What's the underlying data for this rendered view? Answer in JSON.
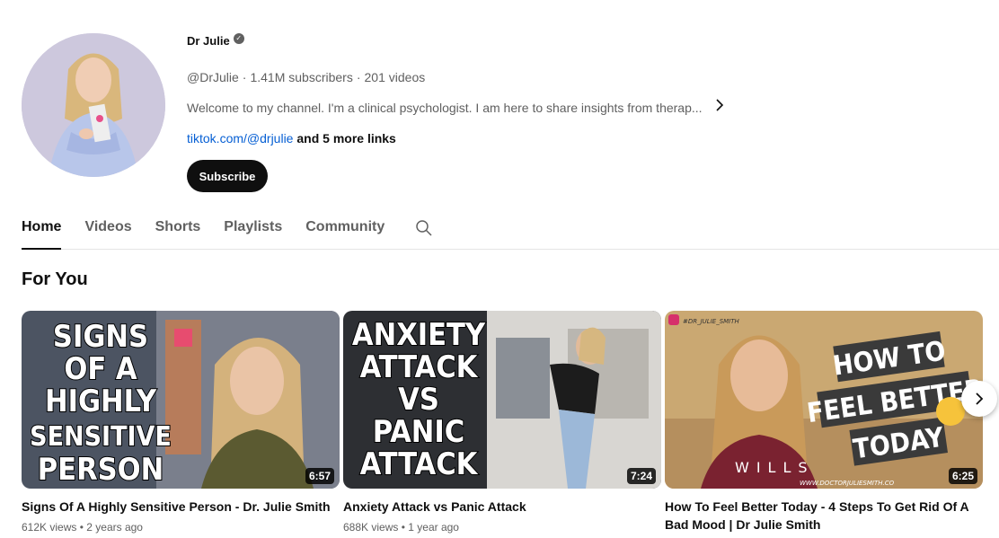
{
  "channel": {
    "name": "Dr Julie",
    "verified_icon": "verified-check-icon",
    "handle": "@DrJulie",
    "subscribers": "1.41M subscribers",
    "videos": "201 videos",
    "separator": "·",
    "description": "Welcome to my channel. I'm a clinical psychologist. I am here to share insights from therap...",
    "link": "tiktok.com/@drjulie",
    "more_links": "and 5 more links",
    "subscribe_label": "Subscribe"
  },
  "tabs": [
    {
      "label": "Home",
      "active": true
    },
    {
      "label": "Videos",
      "active": false
    },
    {
      "label": "Shorts",
      "active": false
    },
    {
      "label": "Playlists",
      "active": false
    },
    {
      "label": "Community",
      "active": false
    }
  ],
  "section": {
    "title": "For You"
  },
  "videos": [
    {
      "title": "Signs Of A Highly Sensitive Person - Dr. Julie Smith",
      "views": "612K views",
      "age": "2 years ago",
      "duration": "6:57",
      "thumb_text": [
        "SIGNS",
        "OF A",
        "HIGHLY",
        "SENSITIVE",
        "PERSON"
      ]
    },
    {
      "title": "Anxiety Attack vs Panic Attack",
      "views": "688K views",
      "age": "1 year ago",
      "duration": "7:24",
      "thumb_text": [
        "ANXIETY",
        "ATTACK",
        "VS",
        "PANIC",
        "ATTACK"
      ]
    },
    {
      "title": "How To Feel Better Today - 4 Steps To Get Rid Of A Bad Mood | Dr Julie Smith",
      "views": "",
      "age": "",
      "duration": "6:25",
      "thumb_text": [
        "HOW TO",
        "FEEL BETTER",
        "TODAY"
      ],
      "thumb_handle": "#DR_JULIE_SMITH",
      "thumb_shirt": "WILLS",
      "thumb_url": "WWW.DOCTORJULIESMITH.CO"
    }
  ],
  "icons": {
    "search": "search-icon",
    "next": "chevron-right-icon",
    "desc_more": "chevron-right-icon"
  }
}
